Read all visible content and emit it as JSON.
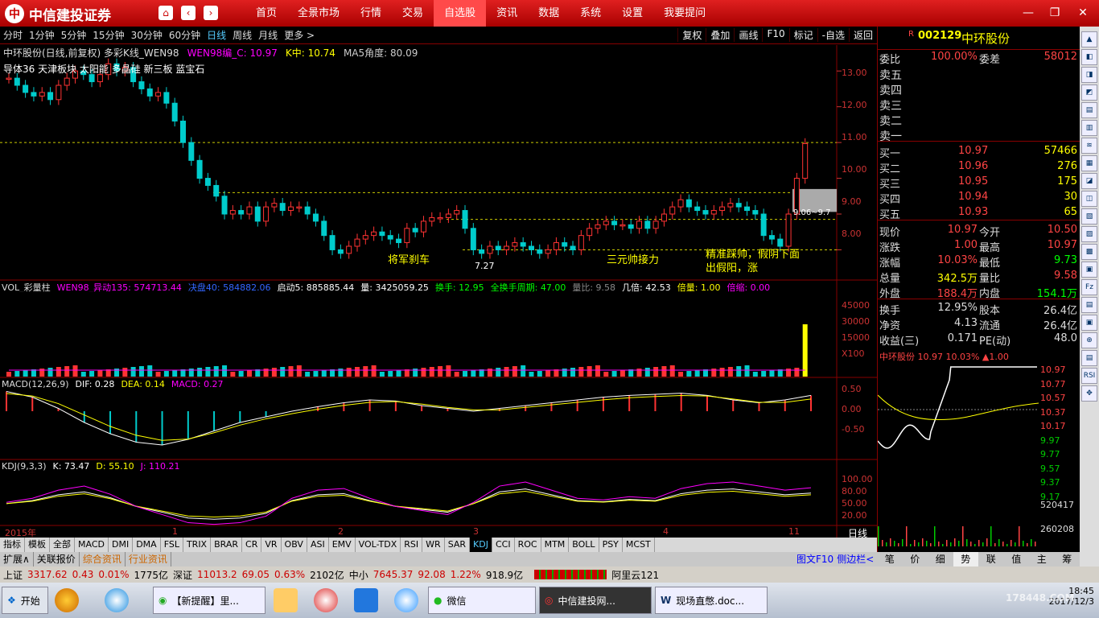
{
  "app": {
    "brand": "中信建投证券",
    "logo_glyph": "中"
  },
  "menu": [
    "首页",
    "全景市场",
    "行情",
    "交易",
    "自选股",
    "资讯",
    "数据",
    "系统",
    "设置",
    "我要提问"
  ],
  "menu_selected": 4,
  "periods": [
    "分时",
    "1分钟",
    "5分钟",
    "15分钟",
    "30分钟",
    "60分钟",
    "日线",
    "周线",
    "月线",
    "更多 >"
  ],
  "period_selected": 6,
  "tools": [
    "复权",
    "叠加",
    "画线",
    "F10",
    "标记",
    "-自选",
    "返回"
  ],
  "chart": {
    "header": "中环股份(日线,前复权) 多彩K线_WEN98",
    "wen": "WEN98编_C: 10.97",
    "kzhong": "K中: 10.74",
    "ma5": "MA5角度: 80.09",
    "concepts": "导体36 天津板块 太阳能 多晶硅 新三板 蓝宝石",
    "annotations": [
      "将军刹车",
      "三元帅接力",
      "精准踩帅，假阴下面",
      "出假阳，涨"
    ],
    "low_label": "7.27",
    "range_label": "9.06~9.7",
    "price_axis": [
      "13.00",
      "12.00",
      "11.00",
      "10.00",
      "9.00",
      "8.00"
    ],
    "vol_header": [
      "VOL_彩量柱",
      "WEN98_异动135: 574713.44",
      "决盘40: 584882.06",
      "启动5: 885885.44",
      "量: 3425059.25",
      "换手: 12.95",
      "全换手周期: 47.00",
      "量比: 9.58",
      "几倍: 42.53",
      "倍量: 1.00",
      "倍缩: 0.00"
    ],
    "vol_axis": [
      "45000",
      "30000",
      "15000",
      "X100"
    ],
    "macd_header": [
      "MACD(12,26,9)",
      "DIF: 0.28",
      "DEA: 0.14",
      "MACD: 0.27"
    ],
    "macd_axis": [
      "0.50",
      "0.00",
      "-0.50"
    ],
    "kdj_header": [
      "KDJ(9,3,3)",
      "K: 73.47",
      "D: 55.10",
      "J: 110.21"
    ],
    "kdj_axis": [
      "100.00",
      "80.00",
      "50.00",
      "20.00"
    ],
    "months": [
      "2015年",
      "1",
      "2",
      "3",
      "4",
      "11"
    ],
    "period_label": "日线",
    "closes": [
      12.8,
      12.6,
      12.4,
      12.3,
      12.4,
      12.2,
      12.6,
      12.8,
      13.0,
      12.9,
      12.7,
      12.9,
      13.2,
      13.0,
      13.1,
      12.7,
      12.5,
      12.3,
      12.4,
      12.1,
      11.6,
      11.0,
      10.5,
      10.0,
      9.8,
      9.5,
      9.0,
      9.1,
      9.0,
      9.2,
      8.8,
      9.2,
      9.3,
      9.1,
      9.2,
      9.2,
      9.0,
      8.8,
      8.4,
      8.0,
      7.9,
      8.1,
      8.3,
      8.4,
      8.5,
      8.4,
      8.3,
      8.2,
      8.6,
      8.5,
      8.8,
      8.9,
      8.9,
      9.0,
      9.1,
      8.6,
      8.0,
      7.9,
      8.1,
      8.0,
      8.1,
      8.2,
      8.1,
      8.0,
      7.9,
      8.0,
      8.2,
      8.1,
      8.0,
      8.4,
      8.6,
      8.7,
      8.8,
      8.7,
      8.7,
      8.6,
      8.8,
      8.6,
      8.8,
      9.0,
      9.2,
      9.4,
      9.2,
      9.1,
      9.0,
      9.1,
      9.2,
      9.3,
      9.2,
      9.1,
      9.0,
      8.4,
      8.3,
      8.1,
      9.0,
      10.0,
      10.97
    ],
    "kdj_k": [
      55,
      60,
      70,
      75,
      65,
      50,
      40,
      30,
      28,
      30,
      38,
      60,
      70,
      72,
      60,
      50,
      45,
      40,
      55,
      75,
      80,
      70,
      60,
      58,
      62,
      60,
      72,
      78,
      80,
      75,
      70,
      73
    ],
    "macd_dif": [
      0.35,
      0.25,
      0.05,
      -0.2,
      -0.4,
      -0.55,
      -0.6,
      -0.5,
      -0.35,
      -0.2,
      -0.1,
      0,
      0.08,
      0.15,
      0.2,
      0.18,
      0.1,
      0.05,
      0.0,
      0.05,
      0.1,
      0.15,
      0.2,
      0.25,
      0.28,
      0.3,
      0.32,
      0.28,
      0.2,
      0.15,
      0.2,
      0.28
    ]
  },
  "quote": {
    "code": "002129",
    "name": "中环股份",
    "r": "R",
    "weibi_label": "委比",
    "weibi": "100.00%",
    "weicha_label": "委差",
    "weicha": "58012",
    "sells": [
      "卖五",
      "卖四",
      "卖三",
      "卖二",
      "卖一"
    ],
    "buys": [
      {
        "l": "买一",
        "p": "10.97",
        "v": "57466"
      },
      {
        "l": "买二",
        "p": "10.96",
        "v": "276"
      },
      {
        "l": "买三",
        "p": "10.95",
        "v": "175"
      },
      {
        "l": "买四",
        "p": "10.94",
        "v": "30"
      },
      {
        "l": "买五",
        "p": "10.93",
        "v": "65"
      }
    ],
    "stats": [
      [
        "现价",
        "10.97",
        "今开",
        "10.50"
      ],
      [
        "涨跌",
        "1.00",
        "最高",
        "10.97"
      ],
      [
        "涨幅",
        "10.03%",
        "最低",
        "9.73"
      ],
      [
        "总量",
        "342.5万",
        "量比",
        "9.58"
      ],
      [
        "外盘",
        "188.4万",
        "内盘",
        "154.1万"
      ],
      [
        "换手",
        "12.95%",
        "股本",
        "26.4亿"
      ],
      [
        "净资",
        "4.13",
        "流通",
        "26.4亿"
      ],
      [
        "收益(三)",
        "0.171",
        "PE(动)",
        "48.0"
      ]
    ],
    "mini_title": "中环股份 10.97 10.03% ▲1.00",
    "mini_axis": [
      "10.97",
      "10.77",
      "10.57",
      "10.37",
      "10.17",
      "9.97",
      "9.77",
      "9.57",
      "9.37",
      "9.17",
      "520417",
      "260208"
    ]
  },
  "indicators": [
    "指标",
    "模板",
    "全部",
    "MACD",
    "DMI",
    "DMA",
    "FSL",
    "TRIX",
    "BRAR",
    "CR",
    "VR",
    "OBV",
    "ASI",
    "EMV",
    "VOL-TDX",
    "RSI",
    "WR",
    "SAR",
    "KDJ",
    "CCI",
    "ROC",
    "MTM",
    "BOLL",
    "PSY",
    "MCST"
  ],
  "indicator_selected": 18,
  "bottom_tabs": [
    "扩展∧",
    "关联报价",
    "综合资讯",
    "行业资讯"
  ],
  "bottom_right": [
    "图文F10",
    "侧边栏<"
  ],
  "right_tabs": [
    "笔",
    "价",
    "细",
    "势",
    "联",
    "值",
    "主",
    "筹"
  ],
  "right_tab_selected": 3,
  "status": {
    "sh_label": "上证",
    "sh": "3317.62",
    "sh_chg": "0.43",
    "sh_pct": "0.01%",
    "sh_amt": "1775亿",
    "sz_label": "深证",
    "sz": "11013.2",
    "sz_chg": "69.05",
    "sz_pct": "0.63%",
    "sz_amt": "2102亿",
    "zx_label": "中小",
    "zx": "7645.37",
    "zx_chg": "92.08",
    "zx_pct": "1.22%",
    "zx_amt": "918.9亿",
    "cloud": "阿里云121"
  },
  "taskbar": {
    "start": "开始",
    "tasks": [
      "【新提醒】里...",
      "",
      "",
      "",
      "",
      "微信",
      "中信建投网...",
      "现场直憋.doc..."
    ],
    "time": "18:45",
    "date": "2017/12/3",
    "watermark": "178448.COM"
  }
}
